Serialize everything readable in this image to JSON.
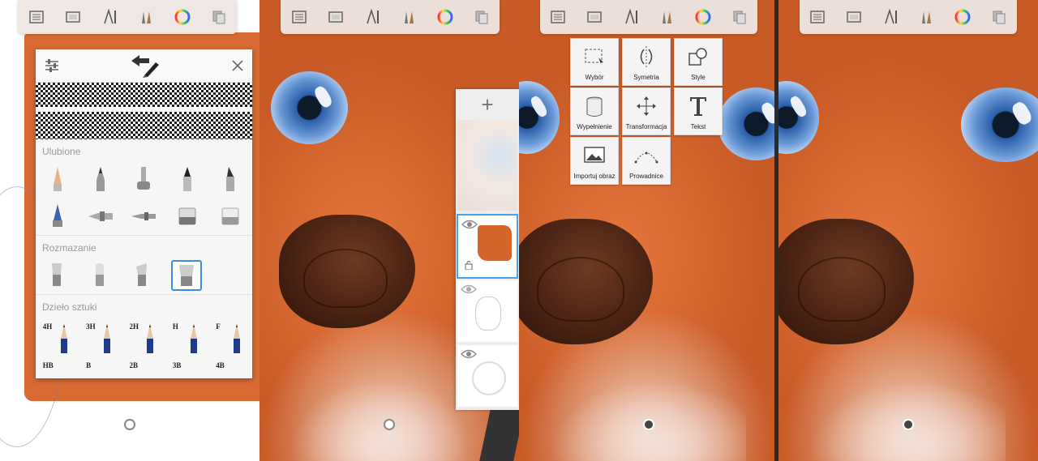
{
  "brush_library": {
    "sections": {
      "favorites": "Ulubione",
      "smudge": "Rozmazanie",
      "artwork": "Dzieło sztuki"
    },
    "pencils_row1": [
      "4H",
      "3H",
      "2H",
      "H",
      "F"
    ],
    "pencils_row2": [
      "HB",
      "B",
      "2B",
      "3B",
      "4B"
    ]
  },
  "layers": {
    "add_label": "+"
  },
  "tools_menu": {
    "items": [
      {
        "label": "Wybór"
      },
      {
        "label": "Symetria"
      },
      {
        "label": "Style"
      },
      {
        "label": "Wypełnienie"
      },
      {
        "label": "Transformacja"
      },
      {
        "label": "Tekst"
      },
      {
        "label": "Importuj obraz"
      },
      {
        "label": "Prowadnice"
      }
    ]
  },
  "toolbar": {
    "icons": [
      "list-icon",
      "canvas-icon",
      "ruler-icon",
      "brushes-icon",
      "color-wheel-icon",
      "layers-icon"
    ]
  },
  "colors": {
    "fur": "#d96a33",
    "selection": "#3b8de0"
  }
}
